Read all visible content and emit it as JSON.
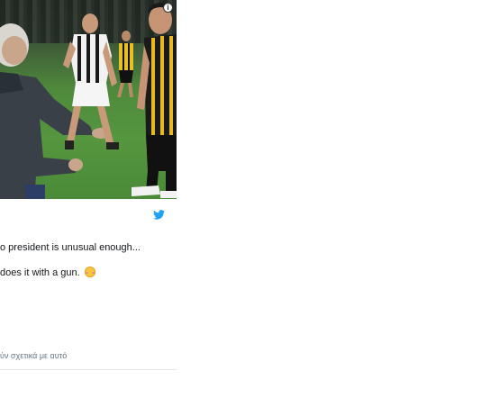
{
  "tweet": {
    "line1": "o president is unusual enough...",
    "line2": "does it with a gun.",
    "emoji_name": "flushed-face-emoji"
  },
  "footer": {
    "related_text": "ύν σχετικά με αυτό"
  },
  "colors": {
    "twitter_blue": "#1da1f2",
    "pitch_green": "#4f8a3c",
    "muted_text": "#657786",
    "divider": "#e1e8ed"
  },
  "icons": {
    "info": "info-icon",
    "twitter": "twitter-bird-icon"
  }
}
